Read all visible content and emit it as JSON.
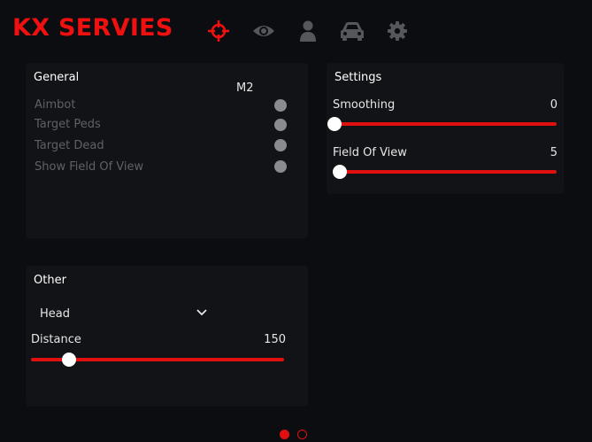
{
  "brand": {
    "title": "KX SERVIES",
    "color": "#f01010"
  },
  "nav": {
    "icons": [
      {
        "name": "crosshair-icon",
        "active": true
      },
      {
        "name": "eye-icon",
        "active": false
      },
      {
        "name": "user-icon",
        "active": false
      },
      {
        "name": "car-icon",
        "active": false
      },
      {
        "name": "gear-icon",
        "active": false
      }
    ]
  },
  "general": {
    "title": "General",
    "key": "M2",
    "options": [
      {
        "label": "Aimbot",
        "enabled": false
      },
      {
        "label": "Target Peds",
        "enabled": false
      },
      {
        "label": "Target Dead",
        "enabled": false
      },
      {
        "label": "Show Field Of View",
        "enabled": false
      }
    ]
  },
  "settings": {
    "title": "Settings",
    "sliders": [
      {
        "label": "Smoothing",
        "value": "0",
        "fraction": 0.0
      },
      {
        "label": "Field Of View",
        "value": "5",
        "fraction": 0.025
      }
    ]
  },
  "other": {
    "title": "Other",
    "dropdown": {
      "selected": "Head"
    },
    "slider": {
      "label": "Distance",
      "value": "150",
      "fraction": 0.15
    }
  },
  "pagination": {
    "pages": 2,
    "current": 1
  },
  "colors": {
    "accent": "#e01010",
    "panel": "#121317",
    "background": "#0c0d10"
  }
}
